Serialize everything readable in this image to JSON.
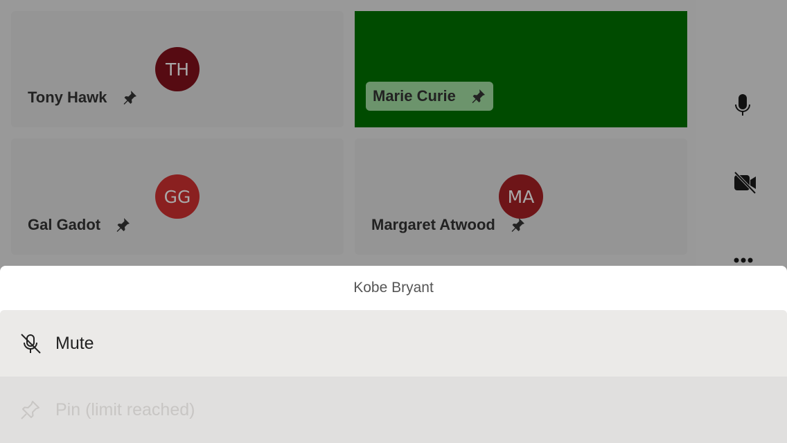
{
  "participants": [
    {
      "name": "Tony Hawk",
      "initials": "TH",
      "avatar_color": "#560b12",
      "video": false
    },
    {
      "name": "Marie Curie",
      "initials": "",
      "video": true,
      "video_color": "#004b00"
    },
    {
      "name": "Gal Gadot",
      "initials": "GG",
      "avatar_color": "#8a2020",
      "video": false
    },
    {
      "name": "Margaret Atwood",
      "initials": "MA",
      "avatar_color": "#6e1518",
      "video": false
    }
  ],
  "controls": [
    "microphone-icon",
    "camera-off-icon",
    "more-icon"
  ],
  "sheet": {
    "title": "Kobe Bryant",
    "items": [
      {
        "label": "Mute",
        "icon": "mic-off-icon",
        "enabled": true
      },
      {
        "label": "Pin (limit reached)",
        "icon": "pin-icon",
        "enabled": false
      }
    ]
  }
}
